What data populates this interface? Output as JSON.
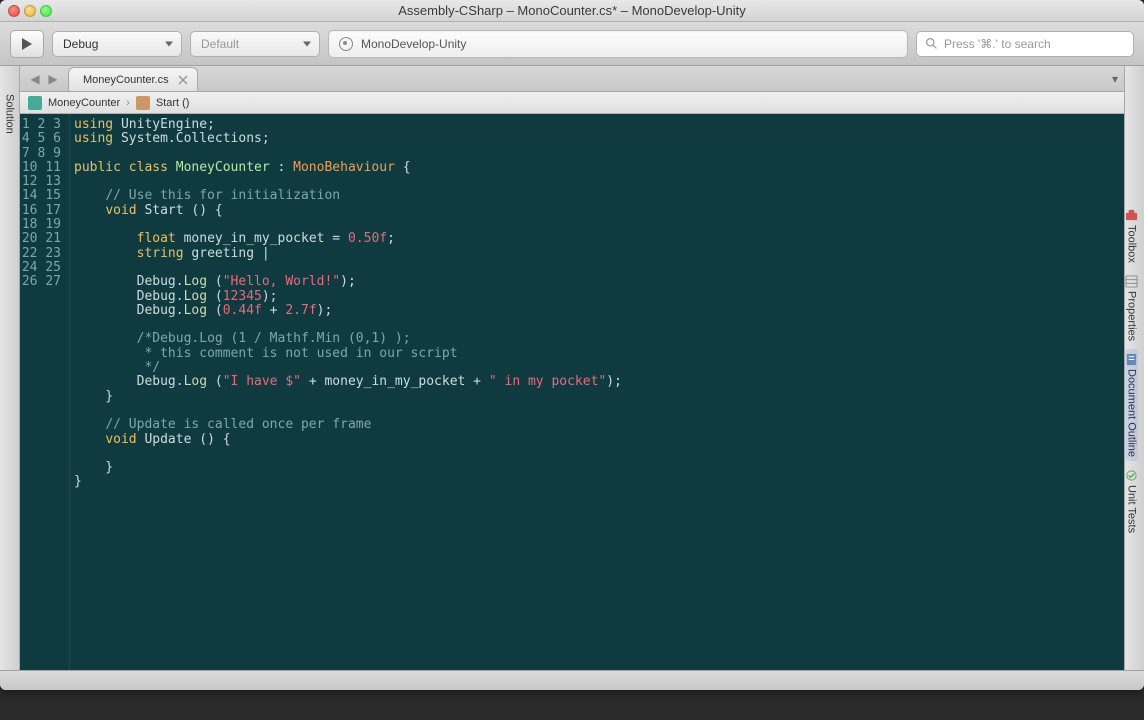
{
  "window": {
    "title": "Assembly-CSharp – MonoCounter.cs* – MonoDevelop-Unity"
  },
  "toolbar": {
    "config": "Debug",
    "platform": "Default",
    "target": "MonoDevelop-Unity",
    "search_placeholder": "Press '⌘.' to search"
  },
  "tabs": {
    "file": "MoneyCounter.cs"
  },
  "breadcrumb": {
    "class": "MoneyCounter",
    "method": "Start ()"
  },
  "side": {
    "left": "Solution",
    "right": [
      "Toolbox",
      "Properties",
      "Document Outline",
      "Unit Tests"
    ]
  },
  "code": {
    "lines": [
      {
        "n": "1",
        "seg": [
          {
            "t": "using ",
            "c": "kw"
          },
          {
            "t": "UnityEngine;",
            "c": ""
          }
        ]
      },
      {
        "n": "2",
        "seg": [
          {
            "t": "using ",
            "c": "kw"
          },
          {
            "t": "System.Collections;",
            "c": ""
          }
        ]
      },
      {
        "n": "3",
        "seg": [
          {
            "t": "",
            "c": ""
          }
        ]
      },
      {
        "n": "4",
        "seg": [
          {
            "t": "public class ",
            "c": "kw"
          },
          {
            "t": "MoneyCounter",
            "c": "type"
          },
          {
            "t": " : ",
            "c": ""
          },
          {
            "t": "MonoBehaviour",
            "c": "cls"
          },
          {
            "t": " {",
            "c": ""
          }
        ]
      },
      {
        "n": "5",
        "seg": [
          {
            "t": "",
            "c": ""
          }
        ]
      },
      {
        "n": "6",
        "seg": [
          {
            "t": "    ",
            "c": ""
          },
          {
            "t": "// Use this for initialization",
            "c": "cm"
          }
        ]
      },
      {
        "n": "7",
        "seg": [
          {
            "t": "    ",
            "c": ""
          },
          {
            "t": "void ",
            "c": "kw"
          },
          {
            "t": "Start () {",
            "c": ""
          }
        ]
      },
      {
        "n": "8",
        "seg": [
          {
            "t": "",
            "c": ""
          }
        ]
      },
      {
        "n": "9",
        "seg": [
          {
            "t": "        ",
            "c": ""
          },
          {
            "t": "float ",
            "c": "kw"
          },
          {
            "t": "money_in_my_pocket = ",
            "c": ""
          },
          {
            "t": "0.50f",
            "c": "num"
          },
          {
            "t": ";",
            "c": ""
          }
        ]
      },
      {
        "n": "10",
        "seg": [
          {
            "t": "        ",
            "c": ""
          },
          {
            "t": "string ",
            "c": "kw"
          },
          {
            "t": "greeting ",
            "c": ""
          },
          {
            "t": "|",
            "c": "cursor"
          }
        ]
      },
      {
        "n": "11",
        "seg": [
          {
            "t": "",
            "c": ""
          }
        ]
      },
      {
        "n": "12",
        "seg": [
          {
            "t": "        Debug.",
            "c": ""
          },
          {
            "t": "Log",
            "c": "method"
          },
          {
            "t": " (",
            "c": ""
          },
          {
            "t": "\"Hello, World!\"",
            "c": "str"
          },
          {
            "t": ");",
            "c": ""
          }
        ]
      },
      {
        "n": "13",
        "seg": [
          {
            "t": "        Debug.",
            "c": ""
          },
          {
            "t": "Log",
            "c": "method"
          },
          {
            "t": " (",
            "c": ""
          },
          {
            "t": "12345",
            "c": "num"
          },
          {
            "t": ");",
            "c": ""
          }
        ]
      },
      {
        "n": "14",
        "seg": [
          {
            "t": "        Debug.",
            "c": ""
          },
          {
            "t": "Log",
            "c": "method"
          },
          {
            "t": " (",
            "c": ""
          },
          {
            "t": "0.44f",
            "c": "num"
          },
          {
            "t": " + ",
            "c": ""
          },
          {
            "t": "2.7f",
            "c": "num"
          },
          {
            "t": ");",
            "c": ""
          }
        ]
      },
      {
        "n": "15",
        "seg": [
          {
            "t": "",
            "c": ""
          }
        ]
      },
      {
        "n": "16",
        "seg": [
          {
            "t": "        ",
            "c": ""
          },
          {
            "t": "/*Debug.Log (1 / Mathf.Min (0,1) );",
            "c": "cm"
          }
        ]
      },
      {
        "n": "17",
        "seg": [
          {
            "t": "         ",
            "c": ""
          },
          {
            "t": "* this comment is not used in our script",
            "c": "cm"
          }
        ]
      },
      {
        "n": "18",
        "seg": [
          {
            "t": "         ",
            "c": ""
          },
          {
            "t": "*/",
            "c": "cm"
          }
        ]
      },
      {
        "n": "19",
        "seg": [
          {
            "t": "        Debug.",
            "c": ""
          },
          {
            "t": "Log",
            "c": "method"
          },
          {
            "t": " (",
            "c": ""
          },
          {
            "t": "\"I have $\"",
            "c": "str"
          },
          {
            "t": " + money_in_my_pocket + ",
            "c": ""
          },
          {
            "t": "\" in my pocket\"",
            "c": "str"
          },
          {
            "t": ");",
            "c": ""
          }
        ]
      },
      {
        "n": "20",
        "seg": [
          {
            "t": "    }",
            "c": ""
          }
        ]
      },
      {
        "n": "21",
        "seg": [
          {
            "t": "",
            "c": ""
          }
        ]
      },
      {
        "n": "22",
        "seg": [
          {
            "t": "    ",
            "c": ""
          },
          {
            "t": "// Update is called once per frame",
            "c": "cm"
          }
        ]
      },
      {
        "n": "23",
        "seg": [
          {
            "t": "    ",
            "c": ""
          },
          {
            "t": "void ",
            "c": "kw"
          },
          {
            "t": "Update () {",
            "c": ""
          }
        ]
      },
      {
        "n": "24",
        "seg": [
          {
            "t": "",
            "c": ""
          }
        ]
      },
      {
        "n": "25",
        "seg": [
          {
            "t": "    }",
            "c": ""
          }
        ]
      },
      {
        "n": "26",
        "seg": [
          {
            "t": "}",
            "c": ""
          }
        ]
      },
      {
        "n": "27",
        "seg": [
          {
            "t": "",
            "c": ""
          }
        ]
      }
    ]
  }
}
